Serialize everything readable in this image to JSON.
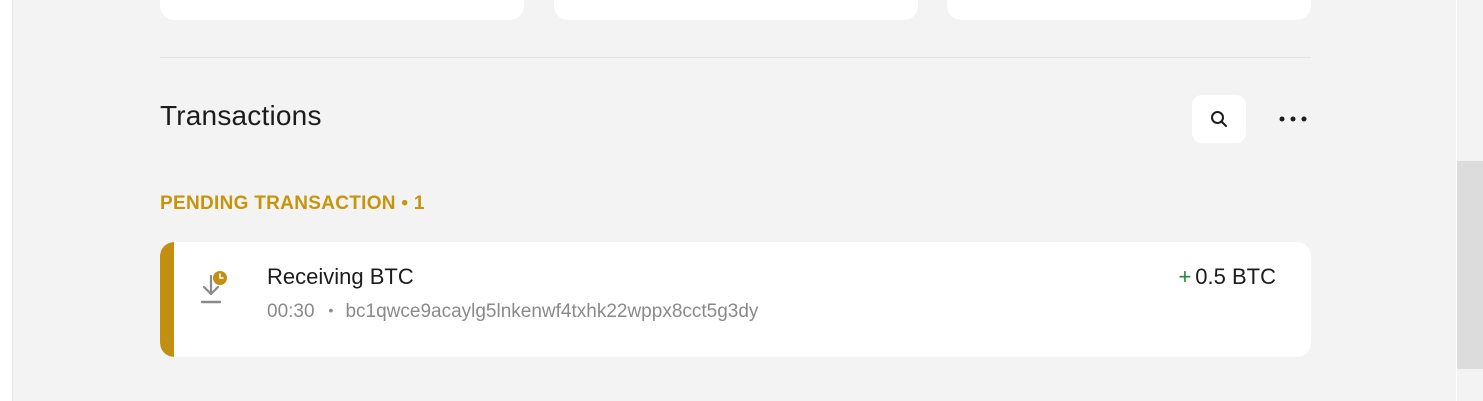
{
  "transactions": {
    "title": "Transactions",
    "pending_label": "PENDING TRANSACTION • 1",
    "items": [
      {
        "title": "Receiving BTC",
        "time": "00:30",
        "separator": "•",
        "address": "bc1qwce9acaylg5lnkenwf4txhk22wppx8cct5g3dy",
        "amount_sign": "+",
        "amount": "0.5 BTC",
        "status": "pending"
      }
    ]
  },
  "icons": {
    "search": "search-icon",
    "more": "more-horizontal-icon",
    "receive_pending": "receive-pending-icon"
  },
  "colors": {
    "background": "#f3f3f3",
    "card": "#ffffff",
    "pending_accent": "#c19010",
    "pending_text": "#c8940c",
    "positive": "#1f8a3c",
    "muted_text": "#8a8a8a"
  }
}
